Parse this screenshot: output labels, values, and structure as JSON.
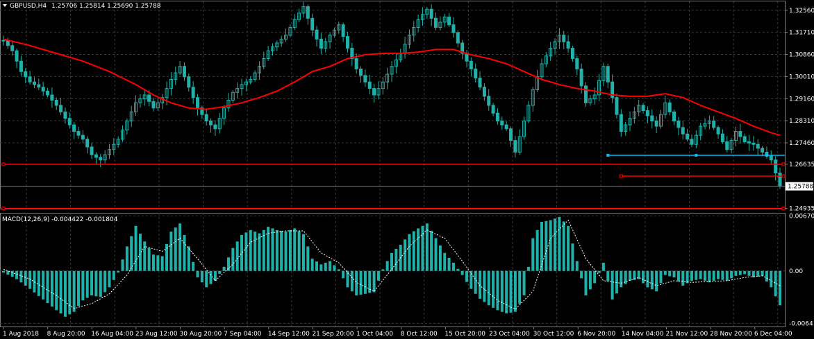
{
  "header": {
    "symbol_caption": "GBPUSD,H4",
    "ohlc_caption": "1.25706 1.25814 1.25690 1.25788",
    "macd_caption": "MACD(12,26,9) -0.004422 -0.001804"
  },
  "colors": {
    "background": "#000000",
    "candles": "#20b2aa",
    "moving_average": "#ff0000",
    "hlines": "#ff0000",
    "support": "#00bfff",
    "signal": "#ffffff",
    "grid": "#3a3a3a",
    "axis_text": "#ffffff"
  },
  "chart_data": [
    {
      "type": "line",
      "title": "GBPUSD,H4",
      "subtitle": "1.25706 1.25814 1.25690 1.25788",
      "x_labels": [
        "1 Aug 2018",
        "8 Aug 20:00",
        "16 Aug 04:00",
        "23 Aug 12:00",
        "30 Aug 20:00",
        "7 Sep 04:00",
        "14 Sep 12:00",
        "21 Sep 20:00",
        "1 Oct 04:00",
        "8 Oct 12:00",
        "15 Oct 20:00",
        "23 Oct 04:00",
        "30 Oct 12:00",
        "6 Nov 20:00",
        "14 Nov 04:00",
        "21 Nov 12:00",
        "28 Nov 20:00",
        "6 Dec 04:00"
      ],
      "y_ticks": [
        "1.32560",
        "1.31710",
        "1.30860",
        "1.30010",
        "1.29160",
        "1.28310",
        "1.27460",
        "1.26635",
        "1.24935"
      ],
      "ylim": [
        1.249,
        1.329
      ],
      "current_price": "1.25788",
      "grid": true,
      "price_path": [
        [
          0,
          1.314
        ],
        [
          2,
          1.31
        ],
        [
          4,
          1.302
        ],
        [
          6,
          1.298
        ],
        [
          8,
          1.296
        ],
        [
          10,
          1.293
        ],
        [
          12,
          1.289
        ],
        [
          14,
          1.284
        ],
        [
          16,
          1.279
        ],
        [
          18,
          1.276
        ],
        [
          20,
          1.27
        ],
        [
          22,
          1.268
        ],
        [
          24,
          1.272
        ],
        [
          26,
          1.276
        ],
        [
          28,
          1.283
        ],
        [
          30,
          1.29
        ],
        [
          32,
          1.293
        ],
        [
          34,
          1.288
        ],
        [
          36,
          1.292
        ],
        [
          38,
          1.299
        ],
        [
          40,
          1.304
        ],
        [
          42,
          1.296
        ],
        [
          44,
          1.288
        ],
        [
          46,
          1.283
        ],
        [
          48,
          1.28
        ],
        [
          50,
          1.288
        ],
        [
          52,
          1.294
        ],
        [
          54,
          1.297
        ],
        [
          56,
          1.299
        ],
        [
          58,
          1.304
        ],
        [
          60,
          1.31
        ],
        [
          62,
          1.313
        ],
        [
          64,
          1.316
        ],
        [
          66,
          1.322
        ],
        [
          68,
          1.327
        ],
        [
          70,
          1.318
        ],
        [
          72,
          1.311
        ],
        [
          74,
          1.316
        ],
        [
          76,
          1.32
        ],
        [
          78,
          1.311
        ],
        [
          80,
          1.303
        ],
        [
          82,
          1.298
        ],
        [
          84,
          1.293
        ],
        [
          86,
          1.298
        ],
        [
          88,
          1.304
        ],
        [
          90,
          1.309
        ],
        [
          92,
          1.316
        ],
        [
          94,
          1.322
        ],
        [
          96,
          1.326
        ],
        [
          98,
          1.319
        ],
        [
          100,
          1.323
        ],
        [
          102,
          1.317
        ],
        [
          104,
          1.309
        ],
        [
          106,
          1.303
        ],
        [
          108,
          1.296
        ],
        [
          110,
          1.289
        ],
        [
          112,
          1.283
        ],
        [
          114,
          1.28
        ],
        [
          116,
          1.271
        ],
        [
          118,
          1.283
        ],
        [
          120,
          1.295
        ],
        [
          122,
          1.305
        ],
        [
          124,
          1.311
        ],
        [
          126,
          1.316
        ],
        [
          128,
          1.311
        ],
        [
          130,
          1.303
        ],
        [
          132,
          1.29
        ],
        [
          134,
          1.293
        ],
        [
          136,
          1.304
        ],
        [
          138,
          1.292
        ],
        [
          140,
          1.279
        ],
        [
          142,
          1.284
        ],
        [
          144,
          1.289
        ],
        [
          146,
          1.285
        ],
        [
          148,
          1.281
        ],
        [
          150,
          1.29
        ],
        [
          152,
          1.283
        ],
        [
          154,
          1.278
        ],
        [
          156,
          1.274
        ],
        [
          158,
          1.281
        ],
        [
          160,
          1.283
        ],
        [
          162,
          1.278
        ],
        [
          164,
          1.272
        ],
        [
          166,
          1.279
        ],
        [
          168,
          1.275
        ],
        [
          170,
          1.274
        ],
        [
          172,
          1.271
        ],
        [
          174,
          1.268
        ],
        [
          176,
          1.258
        ]
      ],
      "series": [
        {
          "name": "",
          "type": "line",
          "points": [
            [
              0,
              1.3145
            ],
            [
              6,
              1.312
            ],
            [
              12,
              1.309
            ],
            [
              18,
              1.306
            ],
            [
              24,
              1.302
            ],
            [
              30,
              1.297
            ],
            [
              34,
              1.293
            ],
            [
              38,
              1.29
            ],
            [
              42,
              1.288
            ],
            [
              46,
              1.2875
            ],
            [
              50,
              1.2885
            ],
            [
              54,
              1.29
            ],
            [
              58,
              1.292
            ],
            [
              62,
              1.2945
            ],
            [
              66,
              1.298
            ],
            [
              70,
              1.302
            ],
            [
              74,
              1.304
            ],
            [
              78,
              1.307
            ],
            [
              82,
              1.3085
            ],
            [
              86,
              1.309
            ],
            [
              90,
              1.309
            ],
            [
              94,
              1.3095
            ],
            [
              98,
              1.3105
            ],
            [
              102,
              1.3105
            ],
            [
              106,
              1.3085
            ],
            [
              110,
              1.307
            ],
            [
              114,
              1.305
            ],
            [
              118,
              1.302
            ],
            [
              122,
              1.299
            ],
            [
              126,
              1.297
            ],
            [
              130,
              1.2955
            ],
            [
              134,
              1.2945
            ],
            [
              138,
              1.293
            ],
            [
              142,
              1.2925
            ],
            [
              146,
              1.2925
            ],
            [
              150,
              1.2935
            ],
            [
              154,
              1.292
            ],
            [
              158,
              1.289
            ],
            [
              162,
              1.2865
            ],
            [
              166,
              1.284
            ],
            [
              170,
              1.281
            ],
            [
              174,
              1.2785
            ],
            [
              176,
              1.2775
            ]
          ]
        }
      ],
      "horizontal_lines": [
        {
          "value": 1.26635,
          "from": 0,
          "to": 176
        },
        {
          "value": 1.2618,
          "from": 140,
          "to": 176
        },
        {
          "value": 1.24935,
          "from": 0,
          "to": 176
        }
      ],
      "support_line": {
        "value": 1.2698,
        "from": 137,
        "to": 176
      }
    },
    {
      "type": "bar",
      "title": "MACD(12,26,9) -0.004422 -0.001804",
      "y_ticks": [
        "0.006705",
        "0.00",
        "-0.006411"
      ],
      "ylim": [
        -0.0068,
        0.0071
      ],
      "macd_path": [
        [
          0,
          -0.0002
        ],
        [
          3,
          -0.001
        ],
        [
          6,
          -0.0022
        ],
        [
          9,
          -0.0035
        ],
        [
          12,
          -0.0048
        ],
        [
          14,
          -0.0056
        ],
        [
          16,
          -0.005
        ],
        [
          18,
          -0.0036
        ],
        [
          20,
          -0.003
        ],
        [
          22,
          -0.0032
        ],
        [
          24,
          -0.002
        ],
        [
          26,
          -0.0002
        ],
        [
          28,
          0.003
        ],
        [
          30,
          0.0055
        ],
        [
          32,
          0.0036
        ],
        [
          34,
          0.002
        ],
        [
          36,
          0.0018
        ],
        [
          38,
          0.0048
        ],
        [
          40,
          0.0058
        ],
        [
          42,
          0.003
        ],
        [
          44,
          -0.0008
        ],
        [
          46,
          -0.002
        ],
        [
          48,
          -0.0012
        ],
        [
          50,
          0.0005
        ],
        [
          52,
          0.0028
        ],
        [
          54,
          0.0044
        ],
        [
          56,
          0.005
        ],
        [
          58,
          0.0046
        ],
        [
          60,
          0.0054
        ],
        [
          62,
          0.005
        ],
        [
          64,
          0.0048
        ],
        [
          66,
          0.0052
        ],
        [
          68,
          0.0045
        ],
        [
          70,
          0.0015
        ],
        [
          72,
          0.0008
        ],
        [
          74,
          0.0012
        ],
        [
          76,
          0.0002
        ],
        [
          78,
          -0.002
        ],
        [
          80,
          -0.003
        ],
        [
          82,
          -0.0028
        ],
        [
          84,
          -0.0026
        ],
        [
          86,
          0.0002
        ],
        [
          88,
          0.0022
        ],
        [
          90,
          0.0032
        ],
        [
          92,
          0.0045
        ],
        [
          94,
          0.0052
        ],
        [
          96,
          0.0058
        ],
        [
          98,
          0.004
        ],
        [
          100,
          0.0022
        ],
        [
          102,
          0.001
        ],
        [
          104,
          -0.0005
        ],
        [
          106,
          -0.0022
        ],
        [
          108,
          -0.0034
        ],
        [
          110,
          -0.0042
        ],
        [
          112,
          -0.0048
        ],
        [
          114,
          -0.0052
        ],
        [
          116,
          -0.005
        ],
        [
          118,
          -0.003
        ],
        [
          120,
          0.004
        ],
        [
          122,
          0.006
        ],
        [
          124,
          0.0062
        ],
        [
          126,
          0.0066
        ],
        [
          128,
          0.0055
        ],
        [
          130,
          0.0012
        ],
        [
          132,
          -0.003
        ],
        [
          134,
          -0.0015
        ],
        [
          136,
          0.001
        ],
        [
          138,
          -0.0035
        ],
        [
          140,
          -0.002
        ],
        [
          142,
          -0.0012
        ],
        [
          144,
          -0.001
        ],
        [
          146,
          -0.002
        ],
        [
          148,
          -0.0025
        ],
        [
          150,
          -0.0005
        ],
        [
          152,
          -0.0008
        ],
        [
          154,
          -0.0018
        ],
        [
          156,
          -0.0012
        ],
        [
          158,
          -0.001
        ],
        [
          160,
          -0.0014
        ],
        [
          162,
          -0.001
        ],
        [
          164,
          -0.0012
        ],
        [
          166,
          -0.0006
        ],
        [
          168,
          -0.0004
        ],
        [
          170,
          -0.0008
        ],
        [
          172,
          -0.0006
        ],
        [
          174,
          -0.002
        ],
        [
          176,
          -0.0042
        ]
      ],
      "signal_path": [
        [
          0,
          0.0002
        ],
        [
          6,
          -0.001
        ],
        [
          12,
          -0.003
        ],
        [
          16,
          -0.0046
        ],
        [
          20,
          -0.004
        ],
        [
          24,
          -0.0028
        ],
        [
          28,
          -0.0005
        ],
        [
          32,
          0.003
        ],
        [
          36,
          0.0024
        ],
        [
          40,
          0.004
        ],
        [
          44,
          0.0015
        ],
        [
          48,
          -0.0012
        ],
        [
          52,
          0.0008
        ],
        [
          56,
          0.0035
        ],
        [
          60,
          0.0046
        ],
        [
          64,
          0.0049
        ],
        [
          68,
          0.0049
        ],
        [
          72,
          0.0022
        ],
        [
          76,
          0.001
        ],
        [
          80,
          -0.0014
        ],
        [
          84,
          -0.0025
        ],
        [
          88,
          0.0002
        ],
        [
          92,
          0.003
        ],
        [
          96,
          0.005
        ],
        [
          100,
          0.004
        ],
        [
          104,
          0.0012
        ],
        [
          108,
          -0.0018
        ],
        [
          112,
          -0.0036
        ],
        [
          116,
          -0.0047
        ],
        [
          120,
          -0.0025
        ],
        [
          124,
          0.004
        ],
        [
          128,
          0.0062
        ],
        [
          132,
          0.0015
        ],
        [
          136,
          -0.0012
        ],
        [
          140,
          -0.0015
        ],
        [
          144,
          -0.0008
        ],
        [
          148,
          -0.0018
        ],
        [
          152,
          -0.0012
        ],
        [
          156,
          -0.0014
        ],
        [
          160,
          -0.0013
        ],
        [
          164,
          -0.0012
        ],
        [
          168,
          -0.0008
        ],
        [
          172,
          -0.0006
        ],
        [
          176,
          -0.0018
        ]
      ]
    }
  ]
}
